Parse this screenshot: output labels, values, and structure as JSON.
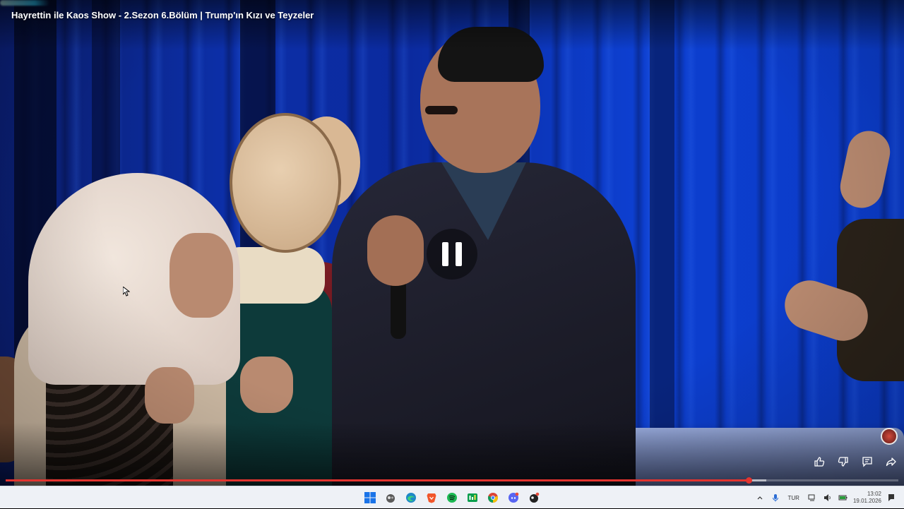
{
  "video": {
    "title": "Hayrettin ile Kaos Show - 2.Sezon 6.Bölüm | Trump'ın Kızı ve Teyzeler",
    "state": "playing",
    "played_fraction": 0.832,
    "buffered_fraction": 0.852
  },
  "actions": {
    "like_icon": "thumb-up-icon",
    "dislike_icon": "thumb-down-icon",
    "comments_icon": "comment-icon",
    "share_icon": "share-icon"
  },
  "taskbar": {
    "apps": [
      "start-icon",
      "app-icon",
      "edge-icon",
      "brave-icon",
      "spotify-icon",
      "app-icon",
      "chrome-icon",
      "discord-icon",
      "app-icon"
    ],
    "language": "TUR",
    "time": "13:02",
    "date": "19.01.2026"
  },
  "colors": {
    "progress_played": "#e3342f",
    "taskbar_bg": "#eef1f6",
    "curtain_blue": "#0d3fd0"
  }
}
